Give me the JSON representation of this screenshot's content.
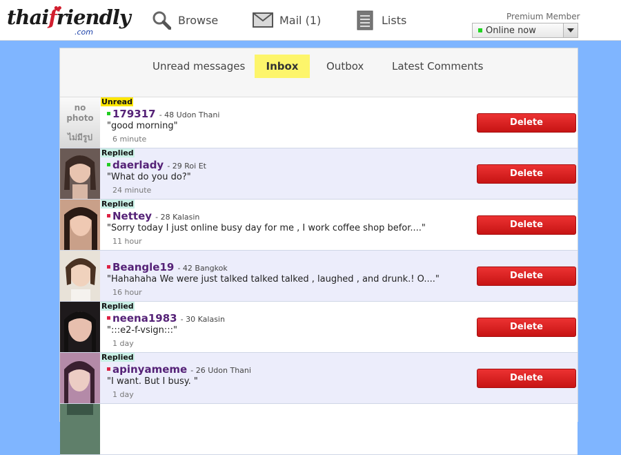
{
  "header": {
    "logo_text": "thaifriendly",
    "logo_suffix": ".com",
    "nav": [
      {
        "label": "Browse",
        "icon": "search-icon"
      },
      {
        "label": "Mail (1)",
        "icon": "mail-icon"
      },
      {
        "label": "Lists",
        "icon": "list-icon"
      }
    ],
    "membership": "Premium Member",
    "status_select": {
      "value": "Online now"
    }
  },
  "tabs": [
    {
      "label": "Unread messages",
      "active": false
    },
    {
      "label": "Inbox",
      "active": true
    },
    {
      "label": "Outbox",
      "active": false
    },
    {
      "label": "Latest Comments",
      "active": false
    }
  ],
  "messages": [
    {
      "badge": "Unread",
      "online": "green",
      "username": "179317",
      "meta": "- 48 Udon Thani",
      "text": "\"good morning\"",
      "time": "6 minute",
      "photo": false,
      "nophoto_label": "no photo",
      "nophoto_thai": "ไม่มีรูป",
      "delete_label": "Delete"
    },
    {
      "badge": "Replied",
      "online": "green",
      "username": "daerlady",
      "meta": "- 29 Roi Et",
      "text": "\"What do you do?\"",
      "time": "24 minute",
      "photo": true,
      "delete_label": "Delete"
    },
    {
      "badge": "Replied",
      "online": "red",
      "username": "Nettey",
      "meta": "- 28 Kalasin",
      "text": "\"Sorry today I just online busy day for me , I work coffee shop befor....\"",
      "time": "11 hour",
      "photo": true,
      "delete_label": "Delete"
    },
    {
      "badge": "",
      "online": "red",
      "username": "Beangle19",
      "meta": "- 42 Bangkok",
      "text": "\"Hahahaha We were just talked talked talked , laughed , and drunk.! O....\"",
      "time": "16 hour",
      "photo": true,
      "delete_label": "Delete"
    },
    {
      "badge": "Replied",
      "online": "red",
      "username": "neena1983",
      "meta": "- 30 Kalasin",
      "text": "\":::e2-f-vsign:::\"",
      "time": "1 day",
      "photo": true,
      "delete_label": "Delete"
    },
    {
      "badge": "Replied",
      "online": "red",
      "username": "apinyameme",
      "meta": "- 26 Udon Thani",
      "text": "\"I want. But I busy. \"",
      "time": "1 day",
      "photo": true,
      "delete_label": "Delete"
    }
  ],
  "colors": {
    "page_bg": "#7fb5ff",
    "active_tab": "#fdf56b",
    "delete_button": "#dd2222",
    "username": "#552277",
    "unread_badge": "#fde600",
    "replied_badge": "#c9f0e6"
  }
}
